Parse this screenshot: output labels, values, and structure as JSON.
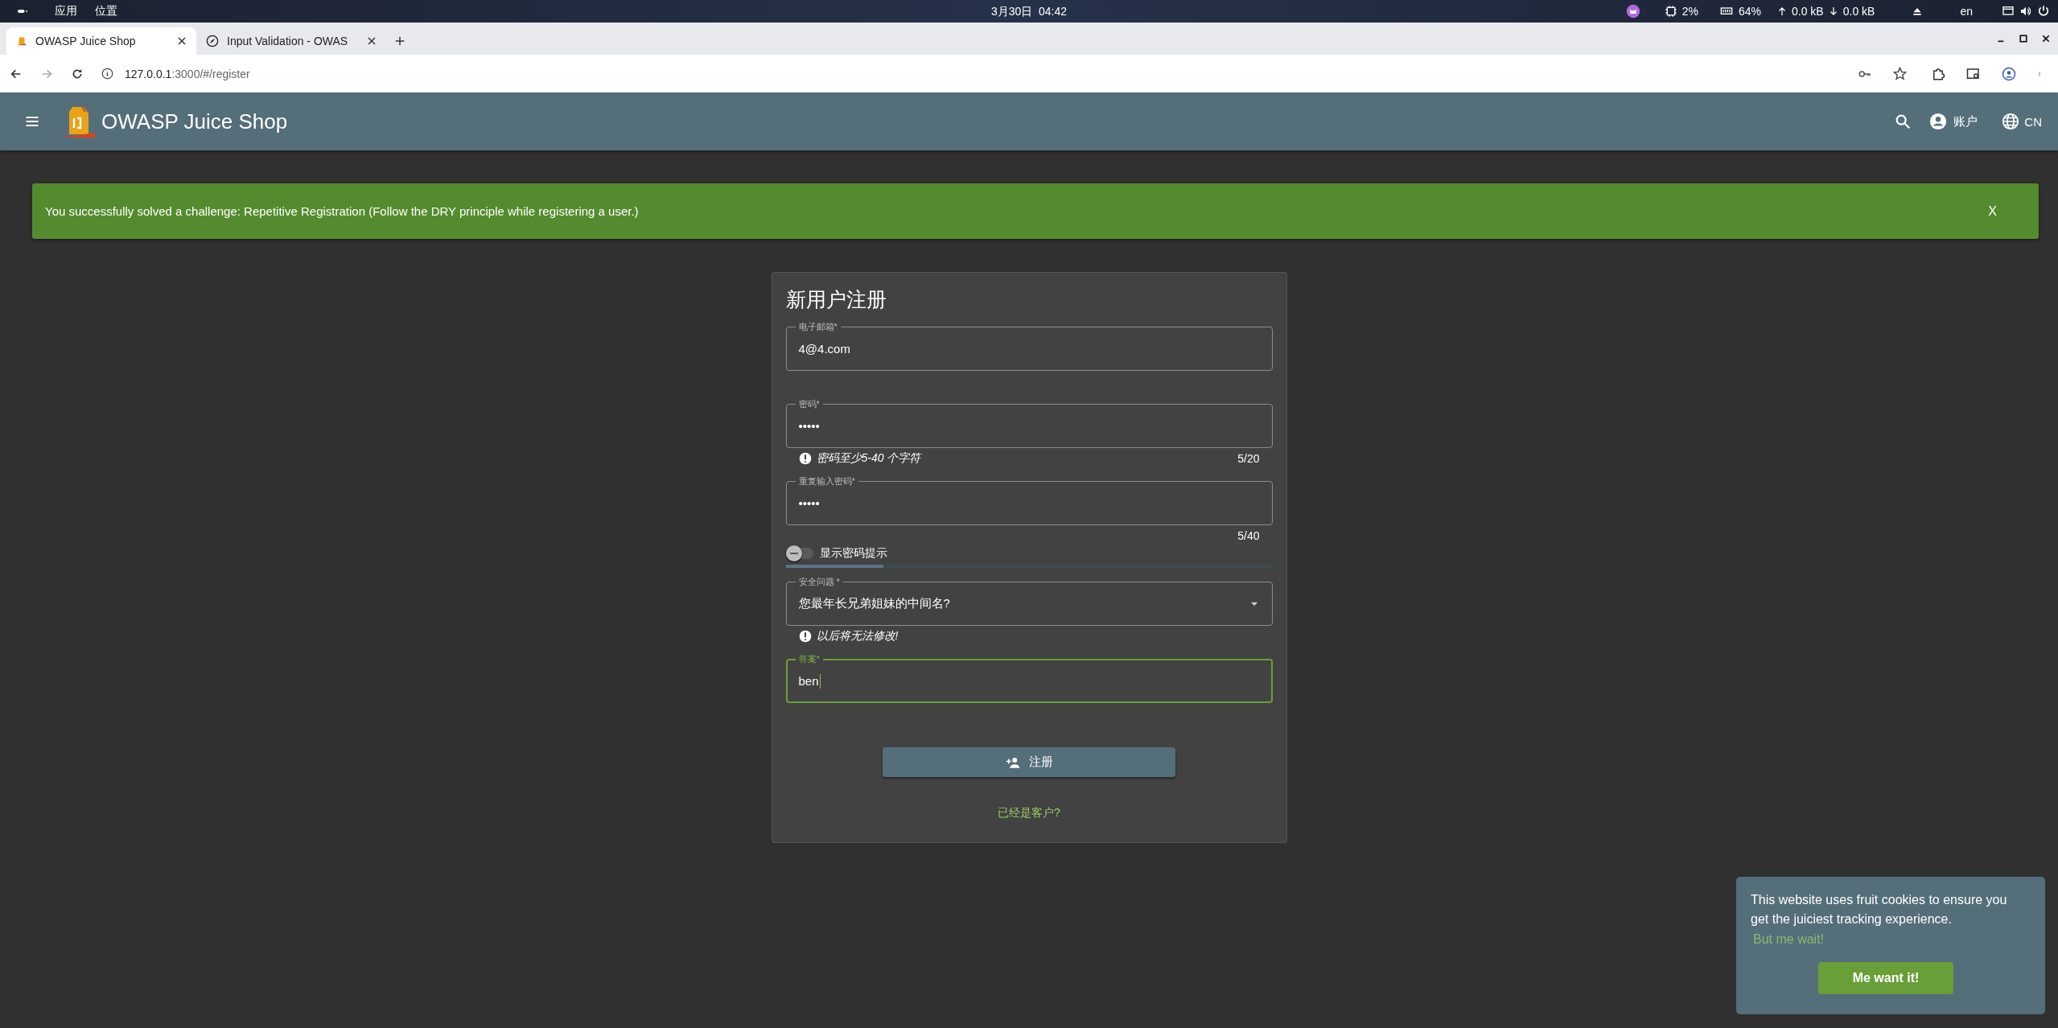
{
  "system_bar": {
    "menus": [
      "应用",
      "位置"
    ],
    "clock": "3月30日  04:42",
    "cpu": "2%",
    "memory": "64%",
    "upload": "0.0 kB",
    "download": "0.0 kB",
    "keyboard": "en"
  },
  "browser": {
    "tabs": [
      {
        "title": "OWASP Juice Shop",
        "selected": true
      },
      {
        "title": "Input Validation - OWAS",
        "selected": false
      }
    ],
    "url_host": "127.0.0.1",
    "url_path": ":3000/#/register"
  },
  "app_bar": {
    "title": "OWASP Juice Shop",
    "account": "账户",
    "language": "CN"
  },
  "notification": {
    "message": "You successfully solved a challenge: Repetitive Registration (Follow the DRY principle while registering a user.)",
    "close": "X"
  },
  "form": {
    "title": "新用户注册",
    "fields": [
      {
        "kind": "text",
        "label": "电子邮箱*",
        "value": "4@4.com",
        "focused": false
      },
      {
        "kind": "text",
        "label": "密码*",
        "value": "•••••",
        "hint": "密码至少5-40 个字符",
        "counter": "5/20",
        "focused": false
      },
      {
        "kind": "text",
        "label": "重复输入密码*",
        "value": "•••••",
        "counter": "5/40",
        "focused": false
      },
      {
        "kind": "toggle",
        "label": "显示密码提示",
        "on": false
      },
      {
        "kind": "meter",
        "level": 0.2
      },
      {
        "kind": "select",
        "label": "安全问题 *",
        "value": "您最年长兄弟姐妹的中间名?",
        "hint": "以后将无法修改!",
        "focused": false
      },
      {
        "kind": "text",
        "label": "答案*",
        "value": "ben",
        "focused": true
      }
    ],
    "submit": "注册",
    "login_link": "已经是客户?"
  },
  "cookie_notice": {
    "message": "This website uses fruit cookies to ensure you get the juiciest tracking experience.",
    "dismiss": "But me wait!",
    "accept": "Me want it!"
  }
}
